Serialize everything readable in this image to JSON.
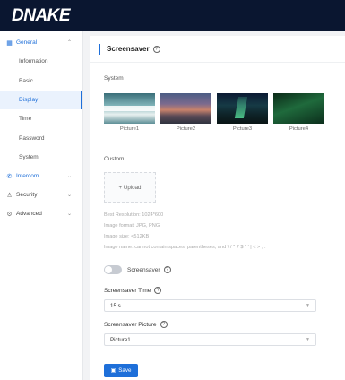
{
  "brand": {
    "logo_text": "DNAKE"
  },
  "sidebar": {
    "general": {
      "label": "General",
      "icon": "grid-icon"
    },
    "general_items": [
      {
        "label": "Information"
      },
      {
        "label": "Basic"
      },
      {
        "label": "Display"
      },
      {
        "label": "Time"
      },
      {
        "label": "Password"
      },
      {
        "label": "System"
      }
    ],
    "active_item": "Display",
    "groups": [
      {
        "label": "Intercom",
        "icon": "phone-icon"
      },
      {
        "label": "Security",
        "icon": "person-icon"
      },
      {
        "label": "Advanced",
        "icon": "gear-icon"
      }
    ]
  },
  "page": {
    "title": "Screensaver"
  },
  "system": {
    "label": "System",
    "pictures": [
      {
        "label": "Picture1"
      },
      {
        "label": "Picture2"
      },
      {
        "label": "Picture3"
      },
      {
        "label": "Picture4"
      }
    ]
  },
  "custom": {
    "label": "Custom",
    "upload_label": "+ Upload",
    "hints": [
      "Best Resolution: 1024*600",
      "Image format: JPG, PNG",
      "Image size: <512KB",
      "Image name: cannot contain spaces, parentheses, and \\ / * ? $ \" ' | < > ; ."
    ]
  },
  "screensaver_toggle": {
    "label": "Screensaver",
    "enabled": false
  },
  "screensaver_time": {
    "label": "Screensaver Time",
    "value": "15 s"
  },
  "screensaver_picture": {
    "label": "Screensaver Picture",
    "value": "Picture1"
  },
  "actions": {
    "save_label": "Save"
  },
  "colors": {
    "accent": "#1e6fd9",
    "topbar": "#0a1630"
  }
}
